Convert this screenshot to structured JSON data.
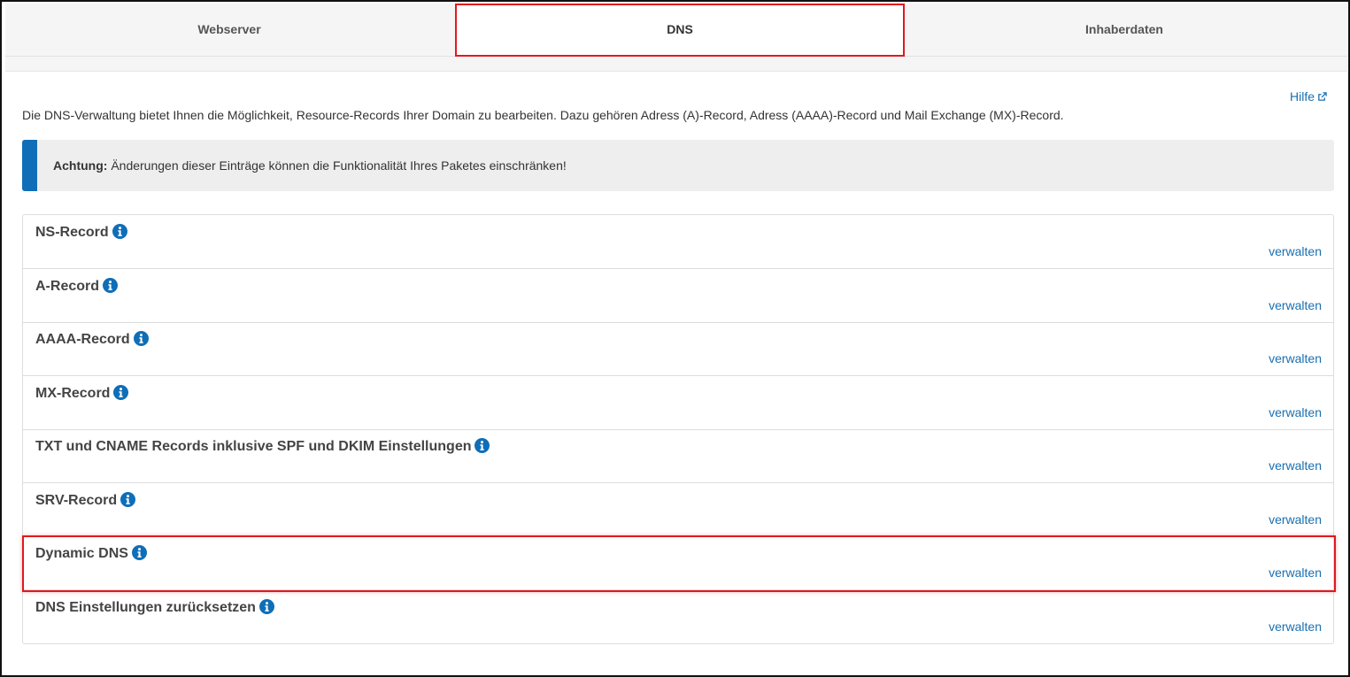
{
  "tabs": [
    {
      "label": "Webserver"
    },
    {
      "label": "DNS"
    },
    {
      "label": "Inhaberdaten"
    }
  ],
  "help_link": "Hilfe",
  "intro_text": "Die DNS-Verwaltung bietet Ihnen die Möglichkeit, Resource-Records Ihrer Domain zu bearbeiten. Dazu gehören Adress (A)-Record, Adress (AAAA)-Record und Mail Exchange (MX)-Record.",
  "alert": {
    "label": "Achtung:",
    "text": " Änderungen dieser Einträge können die Funktionalität Ihres Paketes einschränken!"
  },
  "records": [
    {
      "title": "NS-Record",
      "action": "verwalten"
    },
    {
      "title": "A-Record",
      "action": "verwalten"
    },
    {
      "title": "AAAA-Record",
      "action": "verwalten"
    },
    {
      "title": "MX-Record",
      "action": "verwalten"
    },
    {
      "title": "TXT und CNAME Records inklusive SPF und DKIM Einstellungen",
      "action": "verwalten"
    },
    {
      "title": "SRV-Record",
      "action": "verwalten"
    },
    {
      "title": "Dynamic DNS",
      "action": "verwalten"
    },
    {
      "title": "DNS Einstellungen zurücksetzen",
      "action": "verwalten"
    }
  ],
  "colors": {
    "accent_blue": "#0f6eb7",
    "link_blue": "#1a6fb0",
    "highlight_red": "#e0191f"
  }
}
